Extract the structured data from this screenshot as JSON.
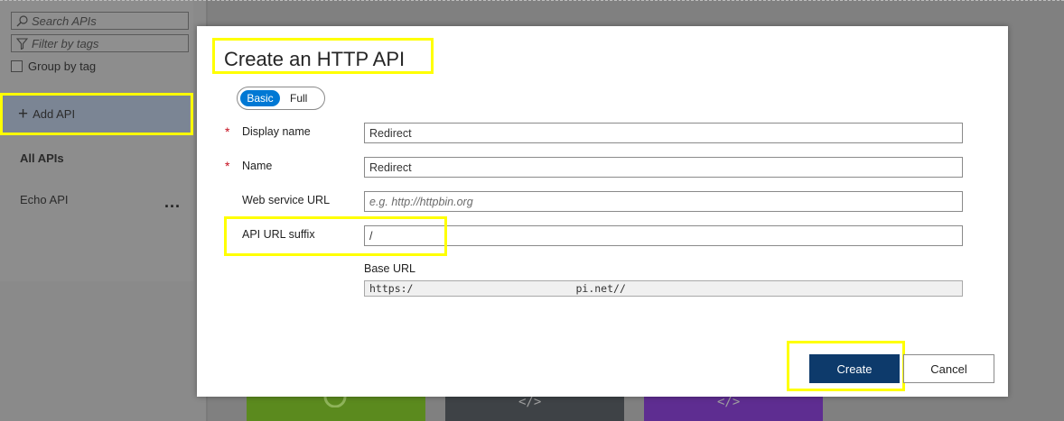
{
  "sidebar": {
    "search_placeholder": "Search APIs",
    "filter_placeholder": "Filter by tags",
    "group_by_tag": "Group by tag",
    "add_api": "Add API",
    "all_apis": "All APIs",
    "apis": [
      {
        "name": "Echo API",
        "more": "..."
      }
    ]
  },
  "tiles": {
    "glyphs": [
      "</>",
      "</>"
    ]
  },
  "dialog": {
    "title": "Create an HTTP API",
    "toggle": {
      "basic": "Basic",
      "full": "Full",
      "selected": "Basic"
    },
    "required_marker": "*",
    "fields": {
      "display_name": {
        "label": "Display name",
        "value": "Redirect"
      },
      "name": {
        "label": "Name",
        "value": "Redirect"
      },
      "web_service_url": {
        "label": "Web service URL",
        "placeholder": "e.g. http://httpbin.org"
      },
      "api_url_suffix": {
        "label": "API URL suffix",
        "value": "/"
      }
    },
    "base_url": {
      "label": "Base URL",
      "value": "https:/                          pi.net//"
    },
    "buttons": {
      "create": "Create",
      "cancel": "Cancel"
    }
  },
  "colors": {
    "accent": "#0078d4",
    "primary_button": "#0d3a6b",
    "highlight": "#ffff00",
    "required": "#c50f1f"
  }
}
